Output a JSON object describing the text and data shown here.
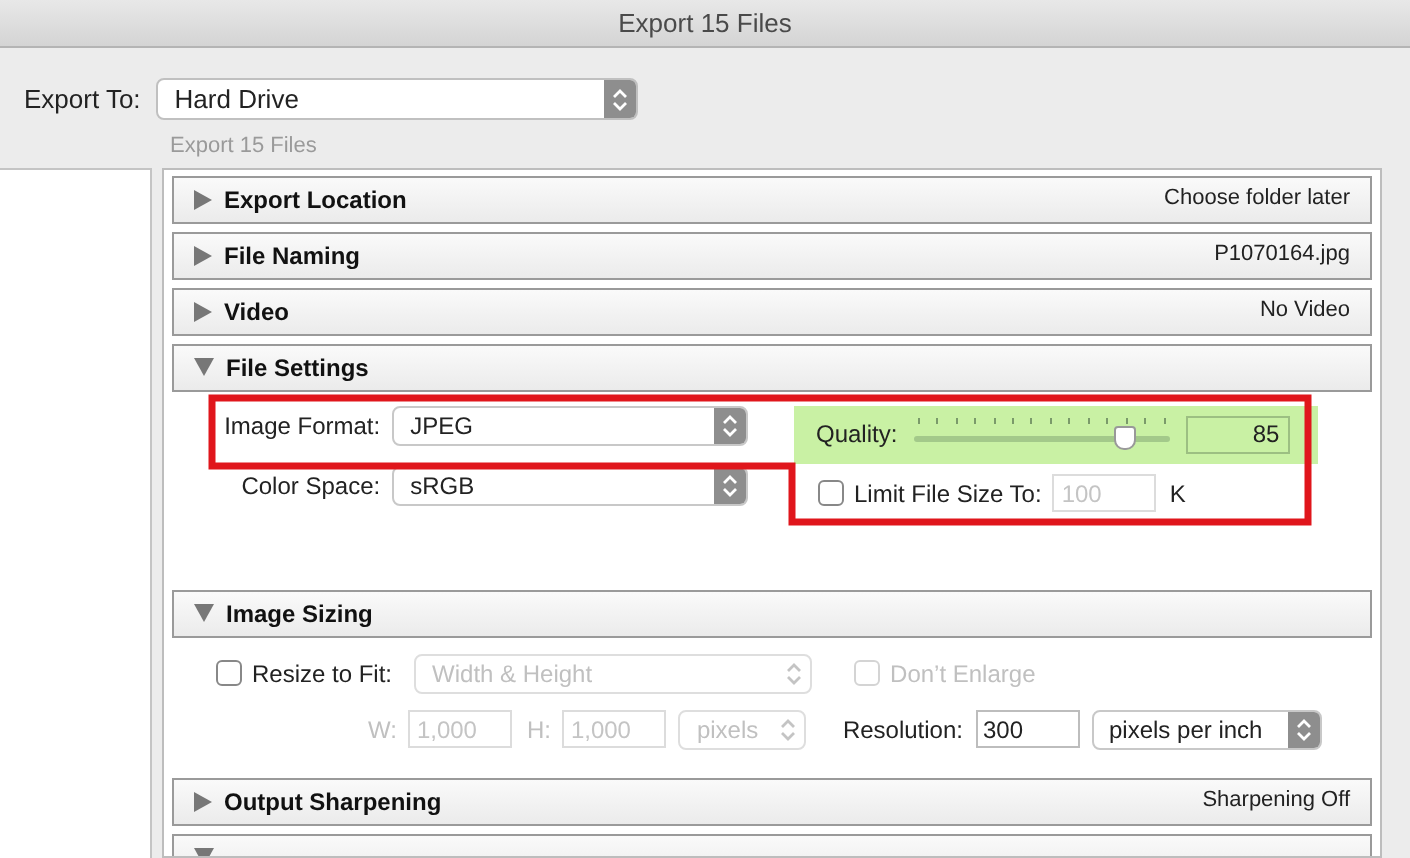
{
  "window": {
    "title": "Export 15 Files"
  },
  "export_to": {
    "label": "Export To:",
    "value": "Hard Drive"
  },
  "preset_caption": "Export 15 Files",
  "sections": [
    {
      "kind": "summary",
      "title": "Export Location",
      "expanded": false,
      "summary": "Choose folder later"
    },
    {
      "kind": "summary",
      "title": "File Naming",
      "expanded": false,
      "summary": "P1070164.jpg"
    },
    {
      "kind": "summary",
      "title": "Video",
      "expanded": false,
      "summary": "No Video"
    },
    {
      "kind": "file_settings",
      "title": "File Settings",
      "expanded": true,
      "image_format": {
        "label": "Image Format:",
        "value": "JPEG"
      },
      "color_space": {
        "label": "Color Space:",
        "value": "sRGB"
      },
      "quality": {
        "label": "Quality:",
        "level": 0.83,
        "value": "85"
      },
      "limit_size": {
        "label": "Limit File Size To:",
        "checked": false,
        "disabled": true,
        "value": "100",
        "unit": "K"
      }
    },
    {
      "kind": "image_sizing",
      "title": "Image Sizing",
      "expanded": true,
      "resize": {
        "label": "Resize to Fit:",
        "checked": false,
        "mode": "Width & Height"
      },
      "dont_enlarge": {
        "label": "Don’t Enlarge",
        "checked": false,
        "disabled": true
      },
      "w": {
        "label": "W:",
        "value": "1,000",
        "disabled": true
      },
      "h": {
        "label": "H:",
        "value": "1,000",
        "disabled": true
      },
      "units": "pixels",
      "resolution": {
        "label": "Resolution:",
        "value": "300",
        "unit": "pixels per inch"
      }
    },
    {
      "kind": "summary",
      "title": "Output Sharpening",
      "expanded": false,
      "summary": "Sharpening Off"
    },
    {
      "kind": "summary",
      "expanded": true
    }
  ]
}
